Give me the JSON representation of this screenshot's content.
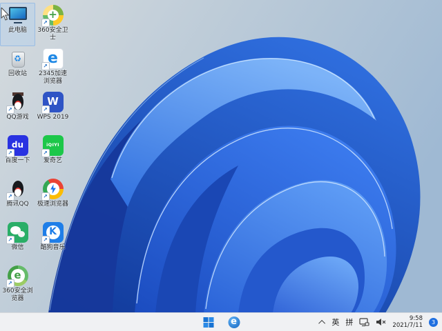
{
  "desktop": {
    "icons": [
      {
        "id": "this-pc",
        "label": "此电脑",
        "glyph": "g-pc",
        "icon_name": "monitor-icon",
        "shortcut": false,
        "selected": true
      },
      {
        "id": "360-safe-guard",
        "label": "360安全卫士",
        "glyph": "g-360safe",
        "icon_name": "shield-plus-icon",
        "shortcut": true,
        "selected": false
      },
      {
        "id": "recycle-bin",
        "label": "回收站",
        "glyph": "g-recycle",
        "icon_name": "recycle-bin-icon",
        "shortcut": false,
        "selected": false
      },
      {
        "id": "2345-browser",
        "label": "2345加速浏览器",
        "glyph": "g-2345",
        "icon_name": "blue-e-browser-icon",
        "shortcut": true,
        "selected": false
      },
      {
        "id": "qq-games",
        "label": "QQ游戏",
        "glyph": "g-qqgame",
        "icon_name": "penguin-pirate-icon",
        "shortcut": true,
        "selected": false
      },
      {
        "id": "wps-2019",
        "label": "WPS 2019",
        "glyph": "g-wps",
        "icon_name": "wps-w-icon",
        "shortcut": true,
        "selected": false
      },
      {
        "id": "baidu",
        "label": "百度一下",
        "glyph": "g-baidu",
        "icon_name": "baidu-du-icon",
        "shortcut": true,
        "selected": false
      },
      {
        "id": "iqiyi",
        "label": "爱奇艺",
        "glyph": "g-iqiyi",
        "icon_name": "iqiyi-icon",
        "shortcut": true,
        "selected": false
      },
      {
        "id": "tencent-qq",
        "label": "腾讯QQ",
        "glyph": "g-qq",
        "icon_name": "qq-penguin-icon",
        "shortcut": true,
        "selected": false
      },
      {
        "id": "speed-browser",
        "label": "极速浏览器",
        "glyph": "g-chrome",
        "icon_name": "chrome-lightning-icon",
        "shortcut": true,
        "selected": false
      },
      {
        "id": "wechat",
        "label": "微信",
        "glyph": "g-wechat",
        "icon_name": "wechat-bubbles-icon",
        "shortcut": true,
        "selected": false
      },
      {
        "id": "kugou-music",
        "label": "酷狗音乐",
        "glyph": "g-kugou",
        "icon_name": "kugou-k-icon",
        "shortcut": true,
        "selected": false
      },
      {
        "id": "360-secure-browser",
        "label": "360安全浏览器",
        "glyph": "g-360se",
        "icon_name": "green-e-browser-icon",
        "shortcut": true,
        "selected": false
      }
    ]
  },
  "taskbar": {
    "tray": {
      "lang_primary": "英",
      "lang_secondary": "拼",
      "time": "9:58",
      "date": "2021/7/11",
      "badge_count": "3"
    }
  },
  "colors": {
    "taskbar_bg": "#f0f1f3",
    "wallpaper_bg_topleft": "#d4dadd",
    "wallpaper_bg_right": "#9fb9d3",
    "bloom_dark": "#16389b",
    "bloom_mid": "#2f6ede",
    "bloom_bright": "#5e9cf5",
    "badge_blue": "#1f6fe0",
    "start_blue": "#1873d3"
  }
}
